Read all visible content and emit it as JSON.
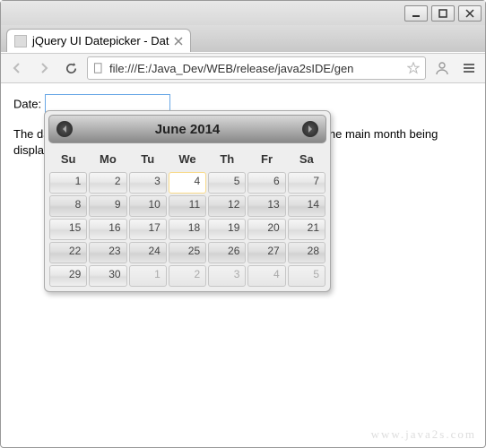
{
  "window": {
    "tab_title": "jQuery UI Datepicker - Dat",
    "url": "file:///E:/Java_Dev/WEB/release/java2sIDE/gen"
  },
  "page": {
    "label": "Date:",
    "input_value": "",
    "body_text": "The datepicker can show multiple months, with the option of the main month being displayed first, last or anywhere in between."
  },
  "datepicker": {
    "title": "June 2014",
    "weekdays": [
      "Su",
      "Mo",
      "Tu",
      "We",
      "Th",
      "Fr",
      "Sa"
    ],
    "weeks": [
      [
        {
          "d": 1,
          "o": false
        },
        {
          "d": 2,
          "o": false
        },
        {
          "d": 3,
          "o": false
        },
        {
          "d": 4,
          "o": false,
          "today": true
        },
        {
          "d": 5,
          "o": false
        },
        {
          "d": 6,
          "o": false
        },
        {
          "d": 7,
          "o": false
        }
      ],
      [
        {
          "d": 8,
          "o": false
        },
        {
          "d": 9,
          "o": false
        },
        {
          "d": 10,
          "o": false
        },
        {
          "d": 11,
          "o": false
        },
        {
          "d": 12,
          "o": false
        },
        {
          "d": 13,
          "o": false
        },
        {
          "d": 14,
          "o": false
        }
      ],
      [
        {
          "d": 15,
          "o": false
        },
        {
          "d": 16,
          "o": false
        },
        {
          "d": 17,
          "o": false
        },
        {
          "d": 18,
          "o": false
        },
        {
          "d": 19,
          "o": false
        },
        {
          "d": 20,
          "o": false
        },
        {
          "d": 21,
          "o": false
        }
      ],
      [
        {
          "d": 22,
          "o": false
        },
        {
          "d": 23,
          "o": false
        },
        {
          "d": 24,
          "o": false
        },
        {
          "d": 25,
          "o": false
        },
        {
          "d": 26,
          "o": false
        },
        {
          "d": 27,
          "o": false
        },
        {
          "d": 28,
          "o": false
        }
      ],
      [
        {
          "d": 29,
          "o": false
        },
        {
          "d": 30,
          "o": false
        },
        {
          "d": 1,
          "o": true
        },
        {
          "d": 2,
          "o": true
        },
        {
          "d": 3,
          "o": true
        },
        {
          "d": 4,
          "o": true
        },
        {
          "d": 5,
          "o": true
        }
      ]
    ]
  },
  "watermark": "www.java2s.com"
}
